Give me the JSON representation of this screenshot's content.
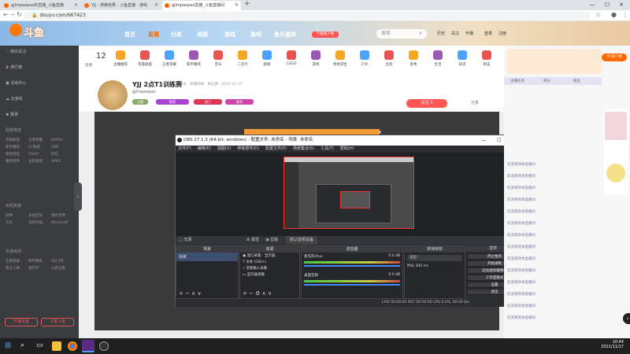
{
  "browser": {
    "tabs": [
      {
        "label": "gjlmpaopao的直播_斗鱼直播"
      },
      {
        "label": "YJJ - 搜索结果 - 斗鱼直播 - 游戏"
      },
      {
        "label": "gjlmpaopao直播_斗鱼直播间"
      }
    ],
    "new_tab": "+",
    "url": "douyu.com/667423"
  },
  "site": {
    "logo": "斗鱼",
    "nav": [
      "首页",
      "直播",
      "分类",
      "视频",
      "游戏",
      "鱼吧",
      "鱼乐盛典"
    ],
    "download_badge": "下载客户端",
    "search_placeholder": "搜索",
    "search_btn": "搜",
    "account": [
      "历史",
      "关注",
      "开播",
      "登录",
      "注册"
    ]
  },
  "sidebar": {
    "items": [
      "我的关注",
      "排行榜",
      "活动中心",
      "云游戏"
    ],
    "section1": "网游竞技",
    "grid1": [
      "英雄联盟",
      "王者荣耀",
      "DOTA2",
      "和平精英",
      "CF穿越",
      "DNF",
      "绝地求生",
      "CSGO",
      "炉石",
      "魔兽世界",
      "主机游戏",
      "APEX"
    ],
    "section2": "单机热游",
    "grid2": [
      "原神",
      "永劫无间",
      "我的世界",
      "方舟",
      "光明大陆",
      "Minecraft"
    ],
    "section3": "手游休闲",
    "grid3": [
      "王者荣耀",
      "和平精英",
      "QQ飞车",
      "第五人格",
      "金铲铲",
      "火影忍者"
    ],
    "buttons": [
      "开播设置",
      "下载斗鱼"
    ]
  },
  "categories": {
    "live_count": "12",
    "items": [
      "主播推荐",
      "英雄联盟",
      "王者荣耀",
      "和平精英",
      "音乐",
      "二次元",
      "颜值",
      "CSGO",
      "游戏",
      "绝地求生",
      "户外",
      "主机",
      "星秀",
      "生活",
      "知识",
      "射击"
    ]
  },
  "room": {
    "title": "YJJ 2点T1训练赛",
    "meta": "鱼丸 · 荣耀勋章 · 粉丝牌 · 2021-11-17",
    "streamer": "gjlmpaopao",
    "badges": [
      "主播",
      "推荐",
      "热门"
    ],
    "follow": "关注 2",
    "share": "分享"
  },
  "obs": {
    "title": "OBS 27.1.3 (64-bit, windows) - 配置文件: 未命名 - 场景: 未命名",
    "menu": [
      "文件(F)",
      "编辑(E)",
      "视图(V)",
      "停靠部件(D)",
      "配置文件(P)",
      "场景集合(S)",
      "工具(T)",
      "帮助(H)"
    ],
    "source_bar": "无源 · 属性 · 滤镜 · 默认音频设备",
    "scene_dock": "场景",
    "scene_item": "场景",
    "sources_dock": "来源",
    "sources": [
      "窗口采集 · 显示器",
      "文本 (GDI+)",
      "音频输入采集",
      "显示器采集"
    ],
    "mixer_dock": "混音器",
    "mixer_items": [
      "桌面音频",
      "麦克风/Aux"
    ],
    "mixer_db": "0.0 dB",
    "trans_dock": "转场特效",
    "trans_sel": "淡出",
    "trans_dur_label": "时长",
    "trans_dur": "300 ms",
    "controls_dock": "控件",
    "buttons": [
      "停止推流",
      "开始录制",
      "启动虚拟摄像机",
      "工作室模式",
      "设置",
      "退出"
    ],
    "status": "LIVE 00:00:00   REC 00:00:00   CPU 0.4%, 60.00 fps"
  },
  "chat": {
    "header_items": [
      "主播任务",
      "积分",
      "粉丝"
    ],
    "lines": [
      "欢迎来到本直播间",
      "欢迎来到本直播间",
      "欢迎来到本直播间",
      "欢迎来到本直播间",
      "欢迎来到本直播间",
      "欢迎来到本直播间",
      "欢迎来到本直播间",
      "欢迎来到本直播间",
      "欢迎来到本直播间",
      "欢迎来到本直播间",
      "欢迎来到本直播间",
      "欢迎来到本直播间",
      "欢迎来到本直播间",
      "欢迎来到本直播间"
    ],
    "pc_btn": "PC客户端",
    "ad": "广告"
  },
  "taskbar": {
    "time": "10:44",
    "date": "2021/11/17"
  }
}
